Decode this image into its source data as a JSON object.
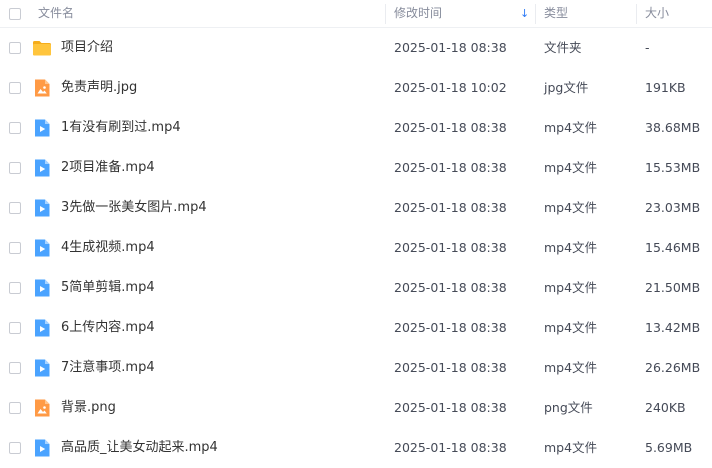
{
  "header": {
    "name": "文件名",
    "modified": "修改时间",
    "type": "类型",
    "size": "大小",
    "sort_indicator": "↓",
    "sort_color": "#2f7cf6"
  },
  "files": [
    {
      "name": "项目介绍",
      "modified": "2025-01-18 08:38",
      "type": "文件夹",
      "size": "-",
      "icon": "folder-icon"
    },
    {
      "name": "免责声明.jpg",
      "modified": "2025-01-18 10:02",
      "type": "jpg文件",
      "size": "191KB",
      "icon": "image-icon"
    },
    {
      "name": "1有没有刷到过.mp4",
      "modified": "2025-01-18 08:38",
      "type": "mp4文件",
      "size": "38.68MB",
      "icon": "video-icon"
    },
    {
      "name": "2项目准备.mp4",
      "modified": "2025-01-18 08:38",
      "type": "mp4文件",
      "size": "15.53MB",
      "icon": "video-icon"
    },
    {
      "name": "3先做一张美女图片.mp4",
      "modified": "2025-01-18 08:38",
      "type": "mp4文件",
      "size": "23.03MB",
      "icon": "video-icon"
    },
    {
      "name": "4生成视频.mp4",
      "modified": "2025-01-18 08:38",
      "type": "mp4文件",
      "size": "15.46MB",
      "icon": "video-icon"
    },
    {
      "name": "5简单剪辑.mp4",
      "modified": "2025-01-18 08:38",
      "type": "mp4文件",
      "size": "21.50MB",
      "icon": "video-icon"
    },
    {
      "name": "6上传内容.mp4",
      "modified": "2025-01-18 08:38",
      "type": "mp4文件",
      "size": "13.42MB",
      "icon": "video-icon"
    },
    {
      "name": "7注意事项.mp4",
      "modified": "2025-01-18 08:38",
      "type": "mp4文件",
      "size": "26.26MB",
      "icon": "video-icon"
    },
    {
      "name": "背景.png",
      "modified": "2025-01-18 08:38",
      "type": "png文件",
      "size": "240KB",
      "icon": "image-icon"
    },
    {
      "name": "高品质_让美女动起来.mp4",
      "modified": "2025-01-18 08:38",
      "type": "mp4文件",
      "size": "5.69MB",
      "icon": "video-icon"
    }
  ],
  "colors": {
    "folder": "#ffc53d",
    "image": "#ff9a45",
    "video": "#4aa3ff"
  }
}
